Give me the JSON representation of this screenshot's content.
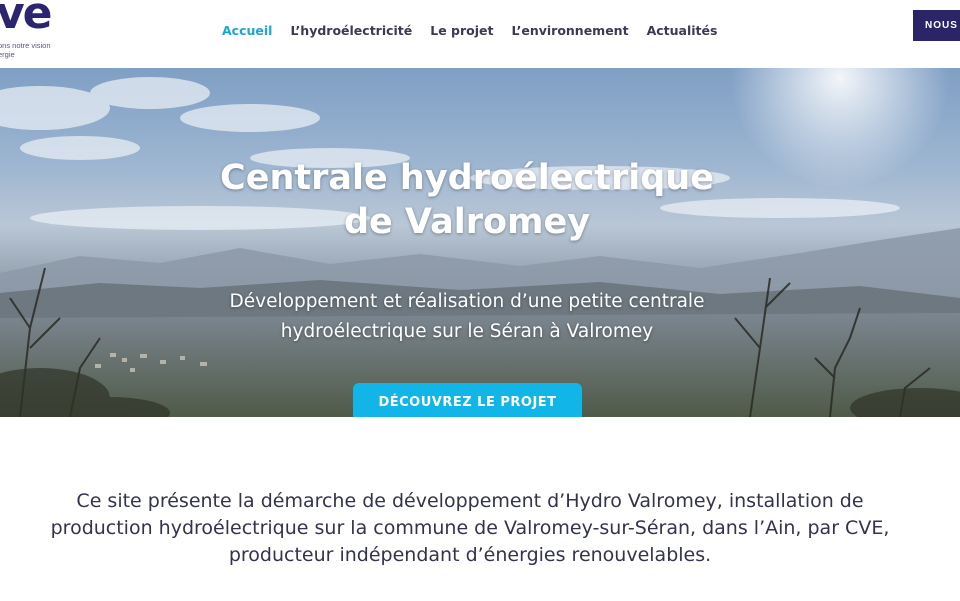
{
  "logo": {
    "mark": "ve",
    "tagline_line1": "ons notre vision",
    "tagline_line2": "ergie"
  },
  "nav": {
    "items": [
      {
        "label": "Accueil",
        "active": true
      },
      {
        "label": "L’hydroélectricité",
        "active": false
      },
      {
        "label": "Le projet",
        "active": false
      },
      {
        "label": "L’environnement",
        "active": false
      },
      {
        "label": "Actualités",
        "active": false
      }
    ],
    "cta_label": "NOUS C"
  },
  "hero": {
    "title_line1": "Centrale hydroélectrique",
    "title_line2": "de Valromey",
    "subtitle_line1": "Développement et réalisation d’une petite centrale",
    "subtitle_line2": "hydroélectrique sur le Séran à Valromey",
    "button_label": "DÉCOUVREZ LE PROJET"
  },
  "intro": {
    "line1": "Ce site présente la démarche de développement d’Hydro Valromey, installation de",
    "line2": "production hydroélectrique sur la commune de Valromey-sur-Séran, dans l’Ain, par CVE,",
    "line3": "producteur indépendant d’énergies renouvelables."
  },
  "colors": {
    "brand_navy": "#2b2466",
    "accent_cyan": "#12b5e8",
    "active_nav": "#1ba6d8"
  }
}
